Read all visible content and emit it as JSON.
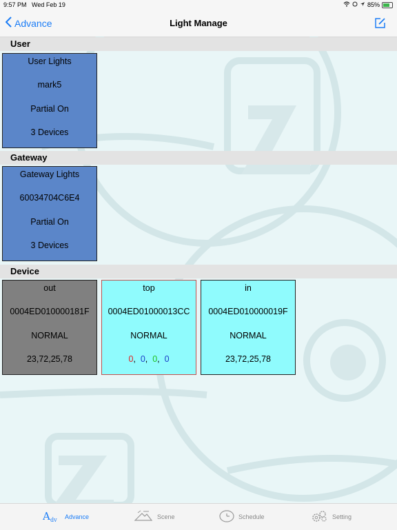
{
  "status": {
    "time": "9:57 PM",
    "date": "Wed Feb 19",
    "battery": "85%"
  },
  "nav": {
    "back_label": "Advance",
    "title": "Light Manage"
  },
  "sections": {
    "user": "User",
    "gateway": "Gateway",
    "device": "Device"
  },
  "user_card": {
    "title": "User Lights",
    "name": "mark5",
    "state": "Partial On",
    "devices": "3 Devices"
  },
  "gateway_card": {
    "title": "Gateway Lights",
    "id": "60034704C6E4",
    "state": "Partial On",
    "devices": "3 Devices"
  },
  "devices": [
    {
      "name": "out",
      "id": "0004ED010000181F",
      "status": "NORMAL",
      "values": "23,72,25,78"
    },
    {
      "name": "top",
      "id": "0004ED01000013CC",
      "status": "NORMAL",
      "values": [
        "0",
        "0",
        "0",
        "0"
      ],
      "value_colors": [
        "#e02020",
        "#1a3cc8",
        "#20c020",
        "#1a3cc8"
      ]
    },
    {
      "name": "in",
      "id": "0004ED010000019F",
      "status": "NORMAL",
      "values": "23,72,25,78"
    }
  ],
  "tabs": [
    {
      "label": "Advance",
      "icon": "advance-icon",
      "active": true
    },
    {
      "label": "Scene",
      "icon": "scene-icon",
      "active": false
    },
    {
      "label": "Schedule",
      "icon": "clock-icon",
      "active": false
    },
    {
      "label": "Setting",
      "icon": "gears-icon",
      "active": false
    }
  ],
  "colors": {
    "accent": "#1a7cf6",
    "card_blue": "#5b86c9",
    "card_gray": "#808080",
    "card_cyan": "#8ffbfd"
  }
}
